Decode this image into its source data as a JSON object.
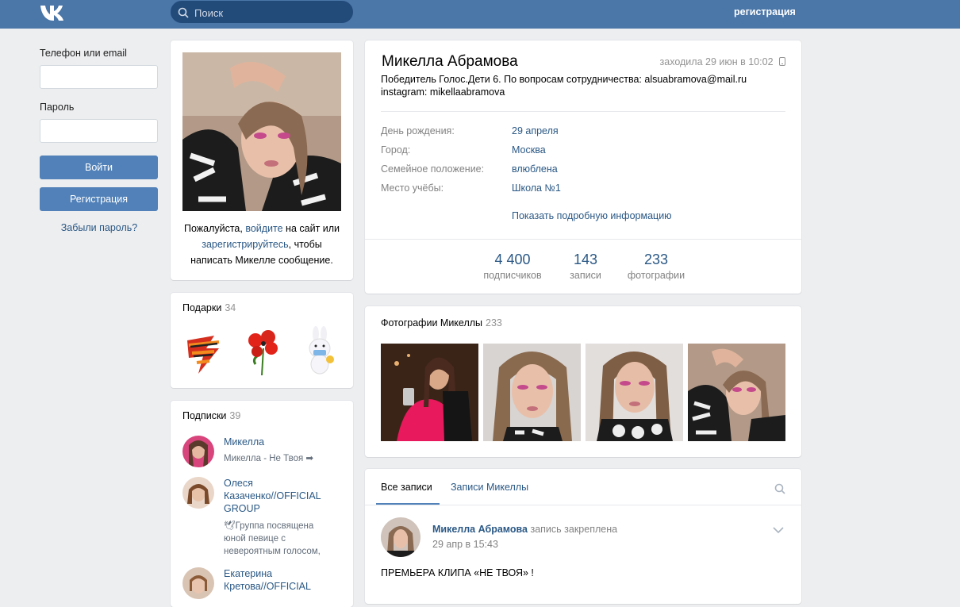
{
  "header": {
    "search_placeholder": "Поиск",
    "register_link": "регистрация"
  },
  "login": {
    "phone_label": "Телефон или email",
    "password_label": "Пароль",
    "login_button": "Войти",
    "register_button": "Регистрация",
    "forgot_link": "Забыли пароль?"
  },
  "avatar_block": {
    "msg_part1": "Пожалуйста, ",
    "msg_link1": "войдите",
    "msg_part2": " на сайт или ",
    "msg_link2": "зарегистрируйтесь",
    "msg_part3": ", чтобы написать Микелле сообщение."
  },
  "gifts": {
    "title": "Подарки",
    "count": "34"
  },
  "subscriptions": {
    "title": "Подписки",
    "count": "39",
    "items": [
      {
        "name": "Микелла",
        "desc": "Микелла - Не Твоя ➡"
      },
      {
        "name": "Олеся Казаченко//OFFICIAL GROUP",
        "desc": "🕊Группа посвящена юной певице с невероятным голосом,"
      },
      {
        "name": "Екатерина Кретова//OFFICIAL",
        "desc": ""
      }
    ]
  },
  "profile": {
    "name": "Микелла Абрамова",
    "last_seen": "заходила 29 июн в 10:02",
    "status_line1": "Победитель Голос.Дети 6. По вопросам сотрудничества: alsuabramova@mail.ru",
    "status_line2": "instagram: mikellaabramova",
    "info": [
      {
        "label": "День рождения:",
        "value": "29 апреля"
      },
      {
        "label": "Город:",
        "value": "Москва"
      },
      {
        "label": "Семейное положение:",
        "value": "влюблена"
      },
      {
        "label": "Место учёбы:",
        "value": "Школа №1"
      }
    ],
    "show_more": "Показать подробную информацию",
    "counters": [
      {
        "num": "4 400",
        "label": "подписчиков"
      },
      {
        "num": "143",
        "label": "записи"
      },
      {
        "num": "233",
        "label": "фотографии"
      }
    ]
  },
  "photos": {
    "title": "Фотографии Микеллы",
    "count": "233"
  },
  "wall": {
    "tab_all": "Все записи",
    "tab_own": "Записи Микеллы",
    "post": {
      "author": "Микелла Абрамова",
      "pinned": "запись закреплена",
      "date": "29 апр в 15:43",
      "text": "ПРЕМЬЕРА КЛИПА «НЕ ТВОЯ» !"
    }
  },
  "colors": {
    "header_bg": "#4a76a8",
    "accent": "#5181b8",
    "link": "#2a5885",
    "page_bg": "#edeef0"
  }
}
